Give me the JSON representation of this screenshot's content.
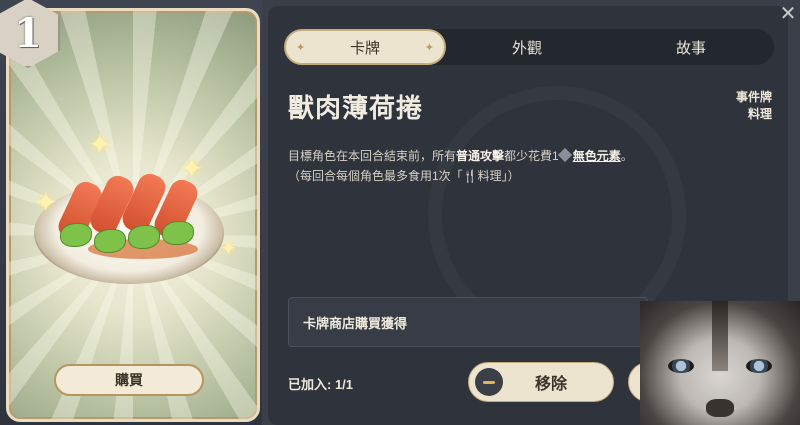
{
  "card": {
    "cost": "1",
    "buy_label": "購買",
    "image": "food-dish-illustration"
  },
  "tabs": [
    {
      "label": "卡牌",
      "active": true
    },
    {
      "label": "外觀",
      "active": false
    },
    {
      "label": "故事",
      "active": false
    }
  ],
  "detail": {
    "title": "獸肉薄荷捲",
    "type_line1": "事件牌",
    "type_line2": "料理",
    "desc_part1": "目標角色在本回合結束前，所有",
    "desc_bold1": "普通攻擊",
    "desc_part2": "都少花費1",
    "desc_bold2": "無色元素",
    "desc_part3": "。",
    "desc_line2": "（每回合每個角色最多食用1次「🍴料理」）",
    "source": "卡牌商店購買獲得",
    "added": "已加入: 1/1",
    "remove_label": "移除"
  },
  "icons": {
    "close": "close-icon",
    "minus": "minus-icon",
    "dice": "omni-dice-icon"
  },
  "colors": {
    "accent": "#ede4d0",
    "panel": "#2e333c",
    "gold": "#c5ab7d"
  }
}
